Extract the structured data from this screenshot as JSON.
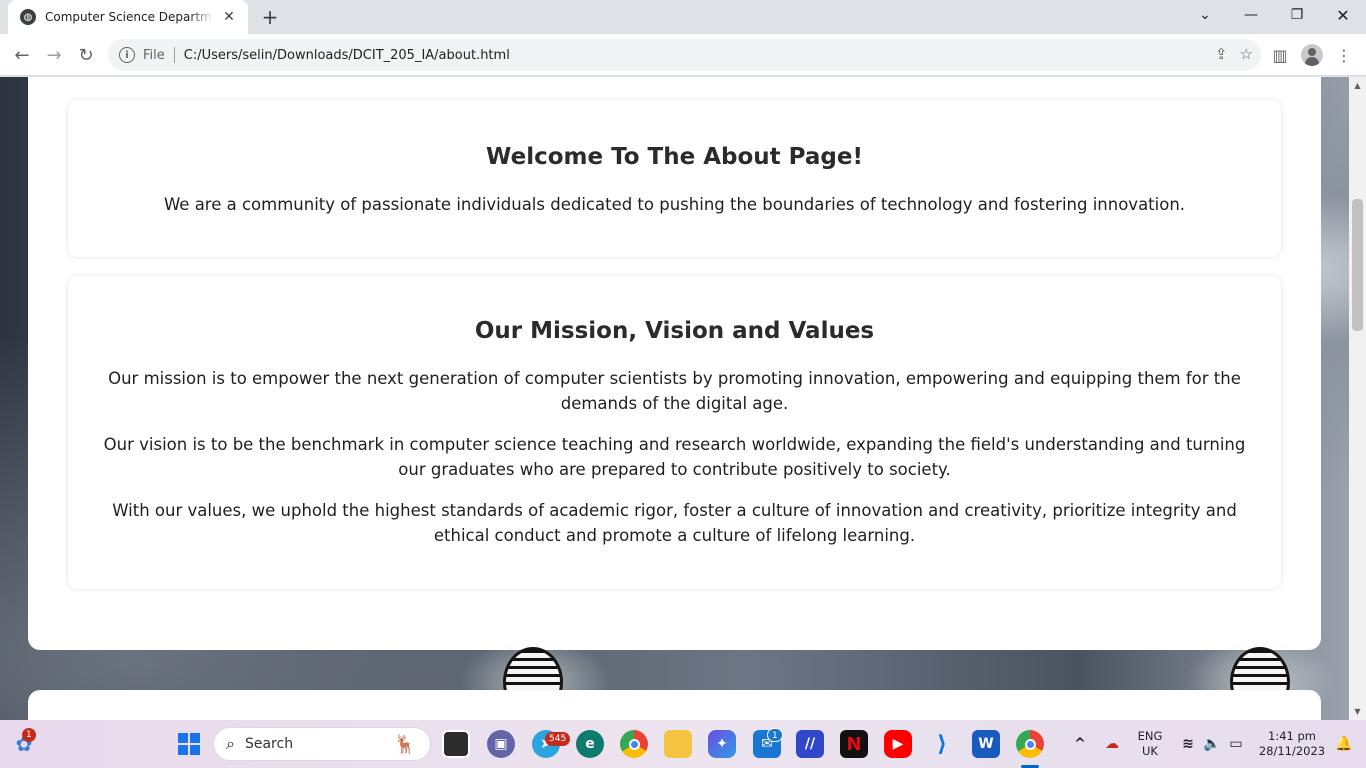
{
  "browser": {
    "tab_title": "Computer Science Department - About",
    "scheme_label": "File",
    "url": "C:/Users/selin/Downloads/DCIT_205_IA/about.html"
  },
  "about": {
    "welcome_heading": "Welcome To The About Page!",
    "welcome_text": "We are a community of passionate individuals dedicated to pushing the boundaries of technology and fostering innovation.",
    "mvv_heading": "Our Mission, Vision and Values",
    "mission_text": "Our mission is to empower the next generation of computer scientists by promoting innovation, empowering and equipping them for the demands of the digital age.",
    "vision_text": "Our vision is to be the benchmark in computer science teaching and research worldwide, expanding the field's understanding and turning our graduates who are prepared to contribute positively to society.",
    "values_text": "With our values, we uphold the highest standards of academic rigor, foster a culture of innovation and creativity, prioritize integrity and ethical conduct and promote a culture of lifelong learning."
  },
  "taskbar": {
    "search_label": "Search",
    "widgets_badge": "1",
    "telegram_badge": "545",
    "mail_badge": "1",
    "lang_primary": "ENG",
    "lang_secondary": "UK",
    "time": "1:41 pm",
    "date": "28/11/2023"
  }
}
